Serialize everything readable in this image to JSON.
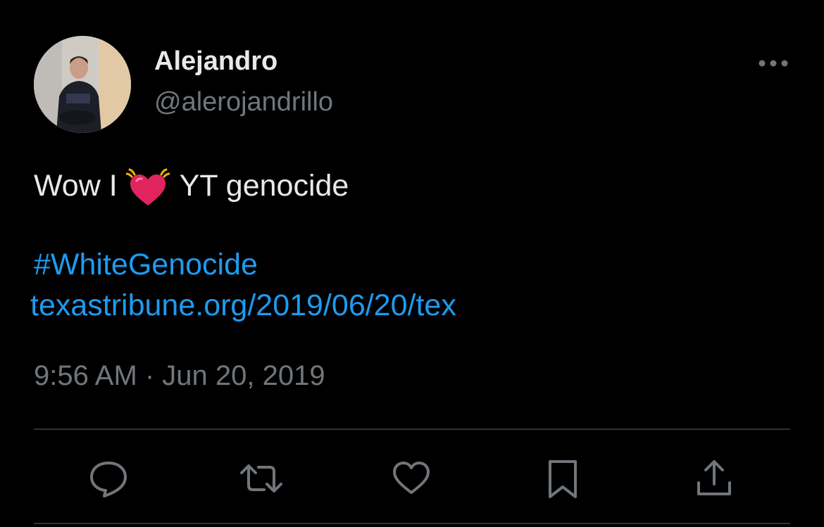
{
  "author": {
    "display_name": "Alejandro",
    "handle": "@alerojandrillo"
  },
  "tweet": {
    "text_before_emoji": "Wow I",
    "emoji": "growing-heart",
    "text_after_emoji": "YT genocide",
    "hashtag": "#WhiteGenocide",
    "link": "texastribune.org/2019/06/20/tex",
    "timestamp": "9:56 AM · Jun 20, 2019"
  },
  "actions": [
    {
      "name": "reply",
      "icon": "speech-bubble-icon"
    },
    {
      "name": "retweet",
      "icon": "retweet-icon"
    },
    {
      "name": "like",
      "icon": "heart-icon"
    },
    {
      "name": "bookmark",
      "icon": "bookmark-icon"
    },
    {
      "name": "share",
      "icon": "share-icon"
    }
  ],
  "colors": {
    "background": "#000000",
    "primary_text": "#e7e9ea",
    "secondary_text": "#71767b",
    "link": "#1d9bf0",
    "divider": "#2f3336",
    "heart_emoji": "#e0245e"
  }
}
